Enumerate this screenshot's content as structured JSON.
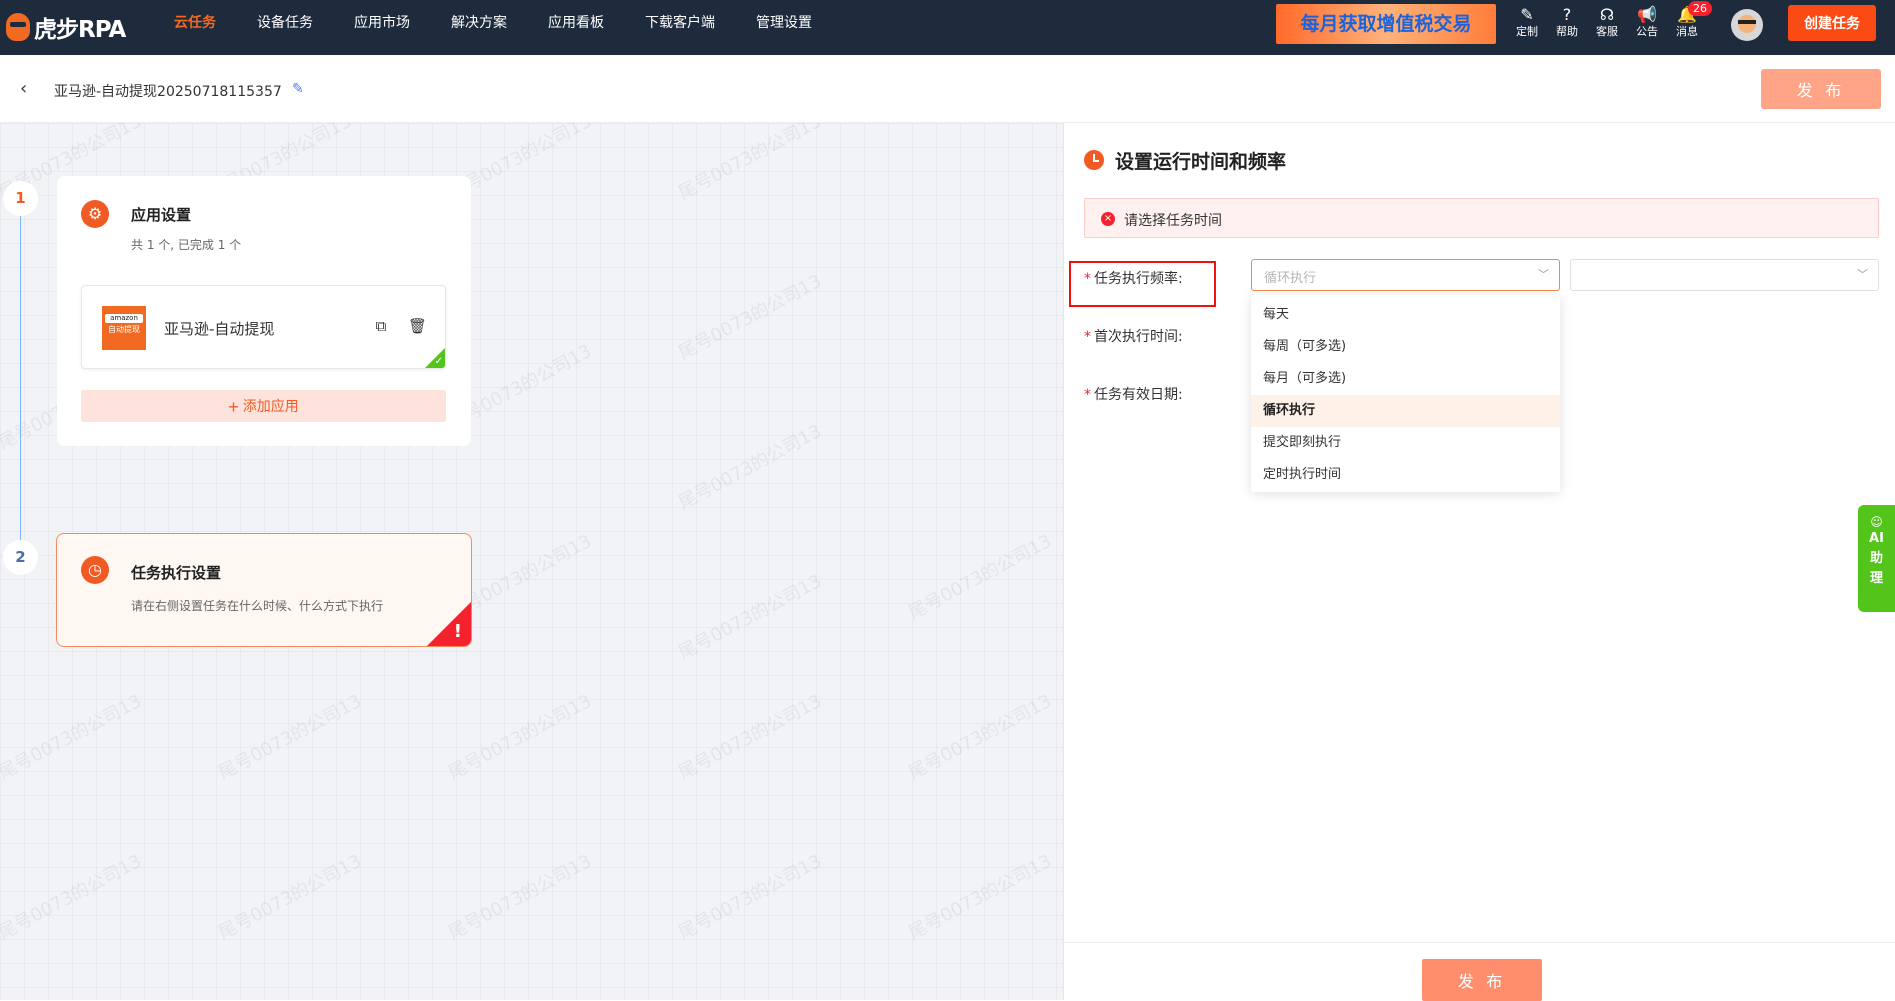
{
  "brand": {
    "name": "虎步RPA"
  },
  "nav": [
    {
      "label": "云任务",
      "active": true
    },
    {
      "label": "设备任务"
    },
    {
      "label": "应用市场"
    },
    {
      "label": "解决方案"
    },
    {
      "label": "应用看板"
    },
    {
      "label": "下载客户端"
    },
    {
      "label": "管理设置"
    }
  ],
  "promo": "每月获取增值税交易",
  "tools": [
    {
      "label": "定制",
      "icon": "customize-icon"
    },
    {
      "label": "帮助",
      "icon": "help-icon"
    },
    {
      "label": "客服",
      "icon": "headset-icon"
    },
    {
      "label": "公告",
      "icon": "megaphone-icon"
    },
    {
      "label": "消息",
      "icon": "bell-icon",
      "badge": "26"
    }
  ],
  "create_button": "创建任务",
  "subbar": {
    "title": "亚马逊-自动提现20250718115357",
    "publish": "发 布"
  },
  "steps": {
    "s1": {
      "num": "1",
      "title": "应用设置",
      "subtitle": "共 1 个, 已完成 1 个",
      "app": {
        "name": "亚马逊-自动提现",
        "logo_top": "amazon",
        "logo_bottom": "自动提现"
      },
      "add_app": "添加应用"
    },
    "s2": {
      "num": "2",
      "title": "任务执行设置",
      "subtitle": "请在右侧设置任务在什么时候、什么方式下执行"
    }
  },
  "panel": {
    "title": "设置运行时间和频率",
    "alert": "请选择任务时间",
    "form": {
      "frequency_label": "任务执行频率:",
      "first_time_label": "首次执行时间:",
      "valid_date_label": "任务有效日期:",
      "frequency_value": "循环执行"
    },
    "dropdown": [
      "每天",
      "每周（可多选)",
      "每月（可多选)",
      "循环执行",
      "提交即刻执行",
      "定时执行时间"
    ],
    "dropdown_selected": 3,
    "publish": "发 布"
  },
  "ai_tab": {
    "l1": "AI",
    "l2": "助",
    "l3": "理"
  },
  "watermark": "尾号0073的公司13",
  "colors": {
    "accent": "#f15a22",
    "topbar": "#1e2b3c",
    "success": "#52c41a",
    "error": "#f5222d"
  }
}
